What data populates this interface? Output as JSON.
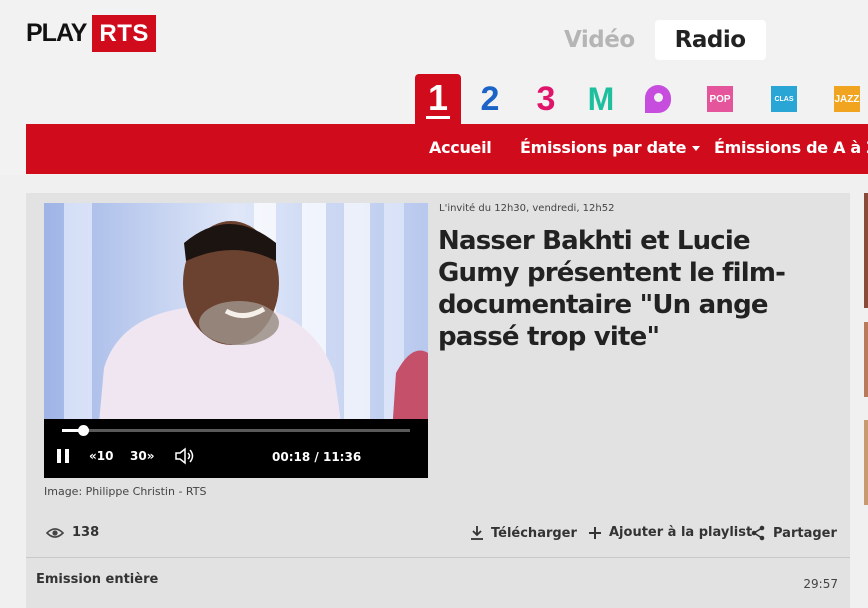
{
  "brand": {
    "play": "PLAY",
    "rts": "RTS"
  },
  "media_tabs": [
    {
      "label": "Vidéo",
      "active": false
    },
    {
      "label": "Radio",
      "active": true
    }
  ],
  "channels": [
    {
      "label": "1",
      "active": true
    },
    {
      "label": "2",
      "active": false
    },
    {
      "label": "3",
      "active": false
    },
    {
      "label": "M",
      "active": false
    },
    {
      "label": "P",
      "active": false
    },
    {
      "label": "Pop",
      "active": false
    },
    {
      "label": "Classic",
      "active": false
    },
    {
      "label": "Jazz",
      "active": false
    }
  ],
  "nav": {
    "home": "Accueil",
    "by_date": "Émissions par date",
    "a_to_z": "Émissions de A à Z"
  },
  "player": {
    "rewind_label": "10",
    "forward_label": "30",
    "current_time": "00:18",
    "separator": "/",
    "duration": "11:36",
    "progress": 0.06
  },
  "article": {
    "meta": "L'invité du 12h30, vendredi, 12h52",
    "title": "Nasser Bakhti et Lucie Gumy présentent le film-documentaire \"Un ange passé trop vite\"",
    "credit": "Image: Philippe Christin - RTS",
    "views": "138"
  },
  "actions": {
    "download": "Télécharger",
    "add_playlist": "Ajouter à la playlist",
    "share": "Partager"
  },
  "episode": {
    "label": "Emission entière",
    "duration": "29:57"
  },
  "colors": {
    "brand_red": "#d00c1c",
    "channel_2": "#1b63c6",
    "channel_3": "#e0146a",
    "channel_m": "#1ebf9f",
    "channel_p": "#c64dde",
    "channel_pop": "#e5559b",
    "channel_classic": "#2aa6d6",
    "channel_jazz": "#f0a41f"
  }
}
